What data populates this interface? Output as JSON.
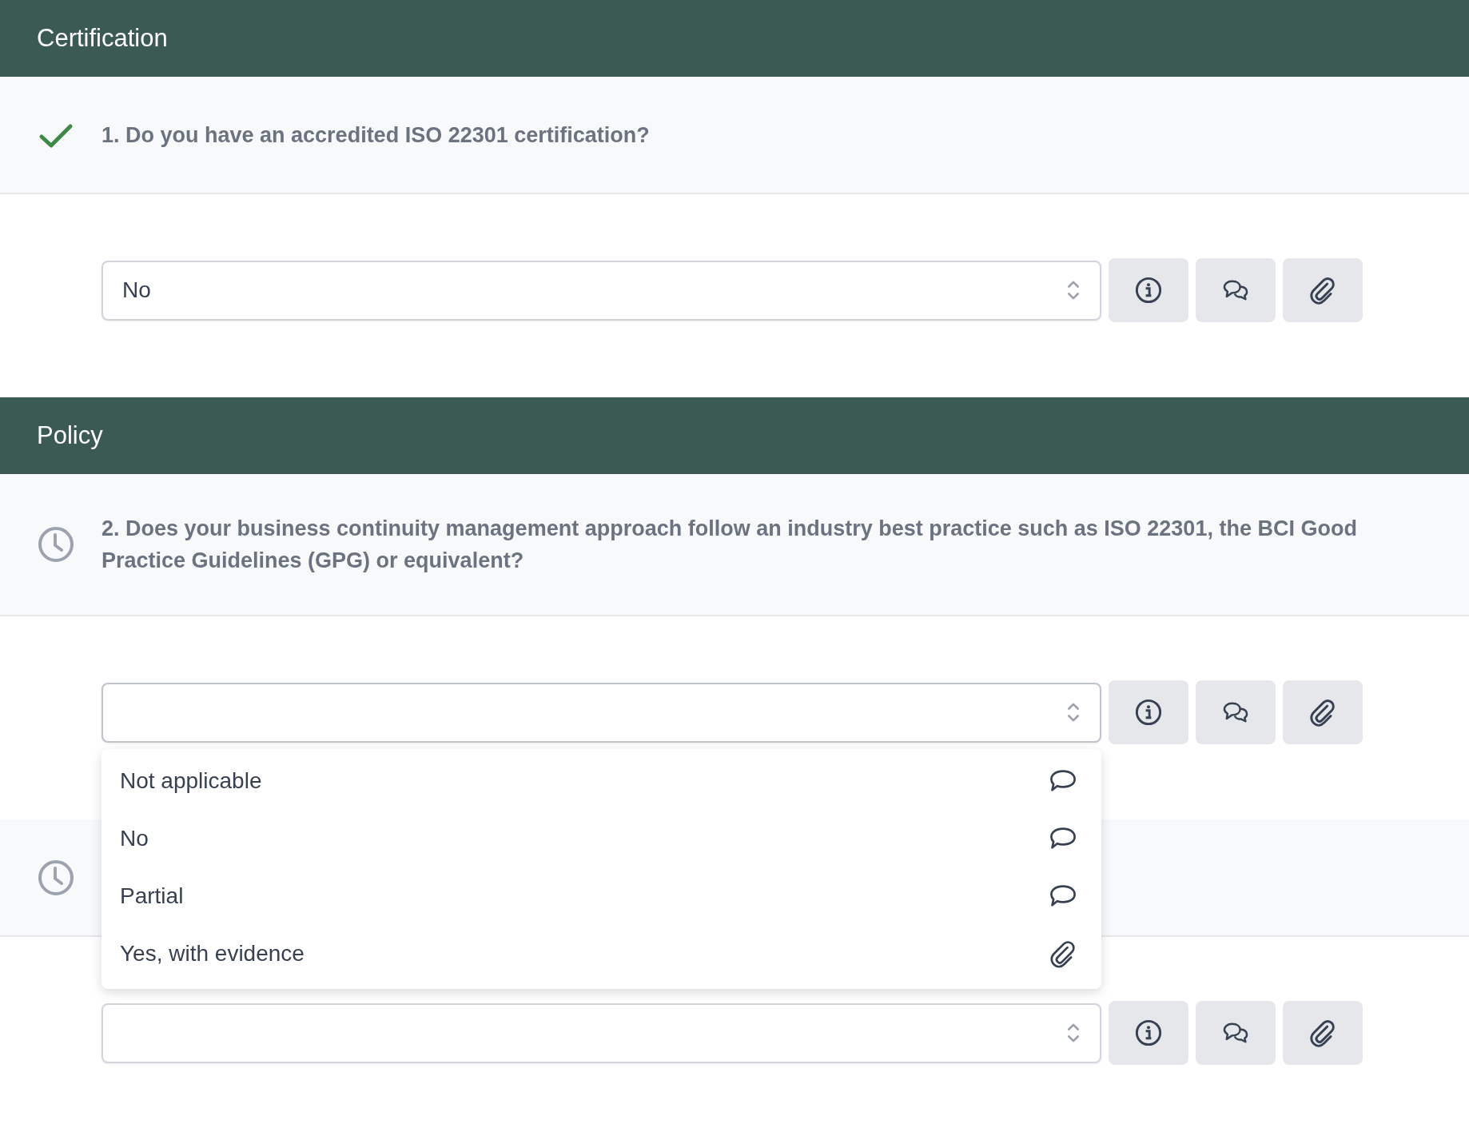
{
  "sections": [
    {
      "title": "Certification",
      "questions": [
        {
          "kind": "done",
          "text": "1. Do you have an accredited ISO 22301 certification?",
          "answer": {
            "value": "No"
          }
        }
      ]
    },
    {
      "title": "Policy",
      "questions": [
        {
          "kind": "pending",
          "text": "2. Does your business continuity management approach follow an industry best practice such as ISO 22301, the BCI Good Practice Guidelines (GPG) or equivalent?",
          "answer": {
            "options": [
              {
                "label": "Not applicable",
                "kind": "comment"
              },
              {
                "label": "No",
                "kind": "comment"
              },
              {
                "label": "Partial",
                "kind": "comment"
              },
              {
                "label": "Yes, with evidence",
                "kind": "attachment"
              }
            ]
          }
        },
        {
          "kind": "pending"
        }
      ]
    }
  ]
}
